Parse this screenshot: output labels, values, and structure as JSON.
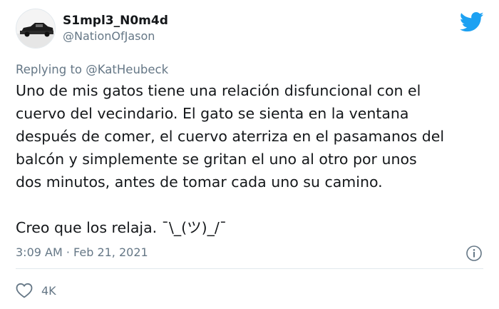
{
  "user": {
    "display_name": "S1mpl3_N0m4d",
    "handle": "@NationOfJason"
  },
  "reply": {
    "prefix": "Replying to ",
    "to_handle": "@KatHeubeck"
  },
  "tweet": {
    "paragraph1": "Uno de mis gatos tiene una relación disfuncional con el\ncuervo del vecindario. El gato se sienta en la ventana\ndespués de comer, el cuervo aterriza en el pasamanos del\nbalcón y simplemente se gritan el uno al otro por unos\ndos minutos, antes de tomar cada uno su camino.",
    "paragraph2": "Creo que los relaja. ¯\\_(ツ)_/¯"
  },
  "meta": {
    "timestamp": "3:09 AM · Feb 21, 2021"
  },
  "engagement": {
    "likes": "4K"
  },
  "icons": {
    "brand": "twitter-bird-icon",
    "info": "info-icon",
    "like": "heart-icon"
  },
  "colors": {
    "twitter_blue": "#1da1f2",
    "secondary_text": "#657786",
    "primary_text": "#14171a",
    "divider": "#e1e8ed"
  }
}
